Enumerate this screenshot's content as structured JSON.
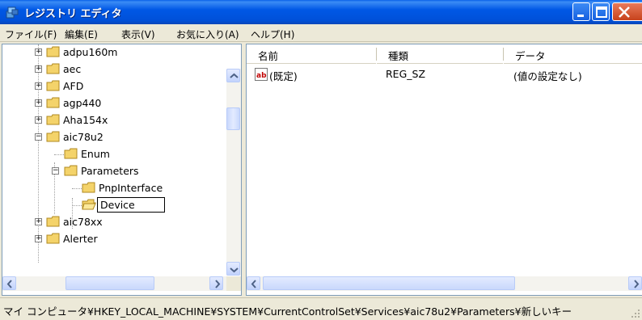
{
  "window": {
    "title": "レジストリ エディタ",
    "buttons": {
      "minimize": "minimize",
      "maximize": "maximize",
      "close": "close"
    }
  },
  "menu": [
    {
      "label": "ファイル(F)"
    },
    {
      "label": "編集(E)"
    },
    {
      "label": "表示(V)"
    },
    {
      "label": "お気に入り(A)"
    },
    {
      "label": "ヘルプ(H)"
    }
  ],
  "tree": {
    "items": [
      {
        "label": "adpu160m",
        "expander": "+",
        "level": 0
      },
      {
        "label": "aec",
        "expander": "+",
        "level": 0
      },
      {
        "label": "AFD",
        "expander": "+",
        "level": 0
      },
      {
        "label": "agp440",
        "expander": "+",
        "level": 0
      },
      {
        "label": "Aha154x",
        "expander": "+",
        "level": 0
      },
      {
        "label": "aic78u2",
        "expander": "-",
        "level": 0
      },
      {
        "label": "Enum",
        "expander": "",
        "level": 1
      },
      {
        "label": "Parameters",
        "expander": "-",
        "level": 1
      },
      {
        "label": "PnpInterface",
        "expander": "",
        "level": 2
      },
      {
        "label": "Device",
        "expander": "",
        "level": 2,
        "editing": true
      },
      {
        "label": "aic78xx",
        "expander": "+",
        "level": 0
      },
      {
        "label": "Alerter",
        "expander": "+",
        "level": 0
      }
    ]
  },
  "list": {
    "columns": [
      "名前",
      "種類",
      "データ"
    ],
    "rows": [
      {
        "name": "(既定)",
        "type": "REG_SZ",
        "data": "(値の設定なし)",
        "icon": "string-value-icon"
      }
    ]
  },
  "status": {
    "path": "マイ コンピュータ¥HKEY_LOCAL_MACHINE¥SYSTEM¥CurrentControlSet¥Services¥aic78u2¥Parameters¥新しいキー"
  },
  "colors": {
    "titlebar": "#0054e3",
    "folder": "#f4d36a",
    "selection_border": "#000000"
  }
}
